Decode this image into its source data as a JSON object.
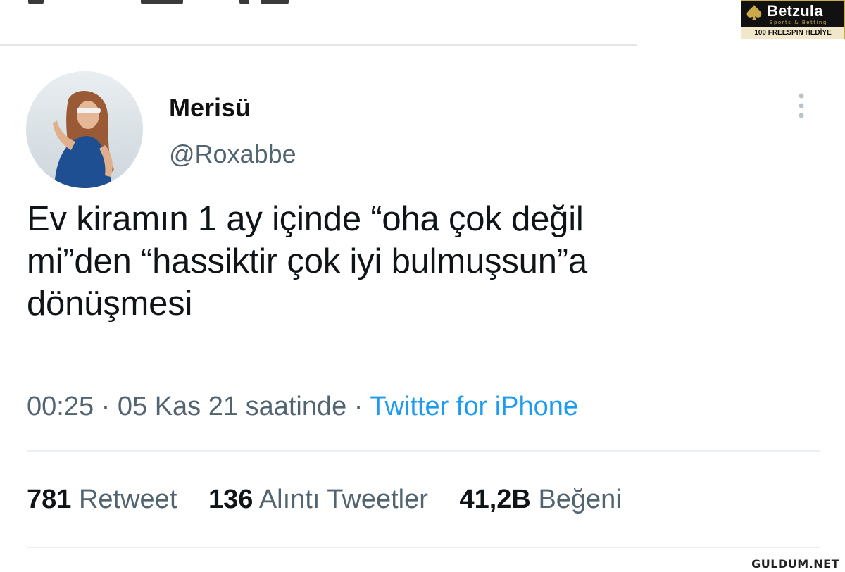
{
  "tweet": {
    "display_name": "Merisü",
    "handle": "@Roxabbe",
    "text_lines": [
      "Ev kiramın 1 ay içinde “oha çok değil",
      "mi”den “hassiktir çok iyi bulmuşsun”a",
      "dönüşmesi"
    ],
    "time": "00:25",
    "date": "05 Kas 21 saatinde",
    "separator": "·",
    "source": "Twitter for iPhone",
    "avatar_icon": "profile-photo",
    "more_icon": "vertical-dots-icon"
  },
  "stats": [
    {
      "count": "781",
      "label": "Retweet"
    },
    {
      "count": "136",
      "label": "Alıntı Tweetler"
    },
    {
      "count": "41,2B",
      "label": "Beğeni"
    }
  ],
  "ad": {
    "brand": "Betzula",
    "tagline": "Sports & Betting",
    "promo": "100 FREESPIN HEDİYE"
  },
  "watermark": "GULDUM.NET",
  "colors": {
    "link": "#1d9bf0",
    "secondary_text": "#536471",
    "primary_text": "#0f1419",
    "divider": "#eceff1"
  }
}
